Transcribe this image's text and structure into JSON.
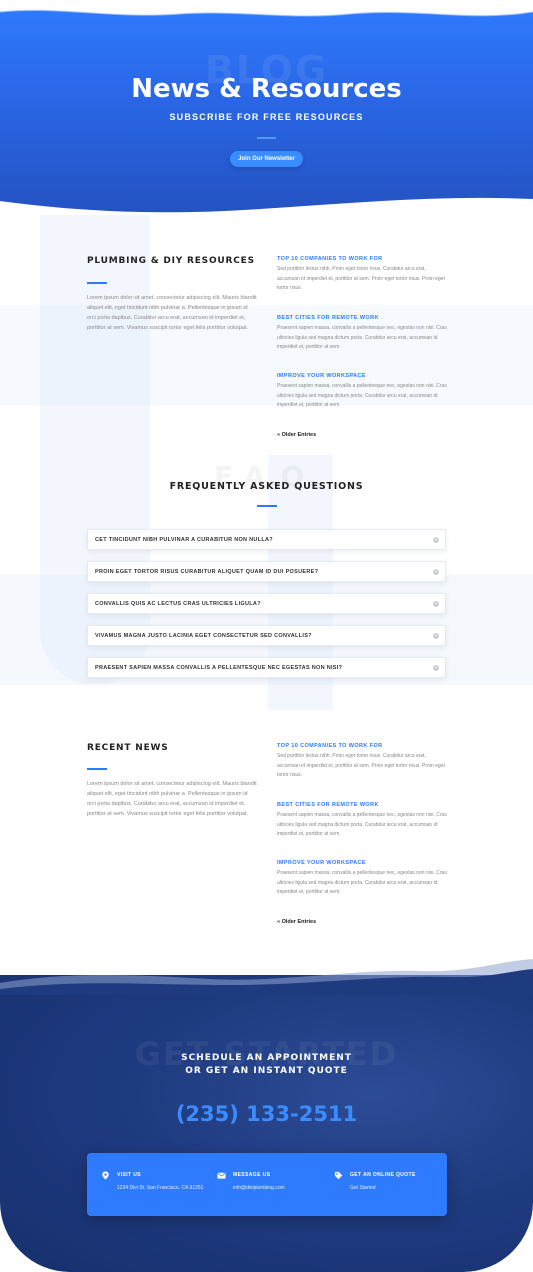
{
  "hero": {
    "ghost_text": "BLOG",
    "title": "News & Resources",
    "subtitle": "SUBSCRIBE FOR FREE RESOURCES",
    "button_label": "Join Our Newsletter"
  },
  "resources": {
    "title": "PLUMBING & DIY RESOURCES",
    "intro": "Lorem ipsum dolor sit amet, consectetur adipiscing elit. Mauris blandit aliquet elit, eget tincidunt nibh pulvinar a. Pellentesque in ipsum id orci porta dapibus. Curabitur arcu erat, accumsan id imperdiet et, porttitor at sem. Vivamus suscipit tortor eget felis porttitor volutpat.",
    "posts": [
      {
        "title": "TOP 10 COMPANIES TO WORK FOR",
        "excerpt": "Sed porttitor lectus nibh. Proin eget tortor risus. Curabitur arcu erat, accumsan id imperdiet et, porttitor at sem. Proin eget tortor risus. Proin eget tortor risus."
      },
      {
        "title": "BEST CITIES FOR REMOTE WORK",
        "excerpt": "Praesent sapien massa, convallis a pellentesque nec, egestas non nisi. Cras ultricies ligula sed magna dictum porta. Curabitur arcu erat, accumsan id imperdiet et, porttitor at sem."
      },
      {
        "title": "IMPROVE YOUR WORKSPACE",
        "excerpt": "Praesent sapien massa, convallis a pellentesque nec, egestas non nisi. Cras ultricies ligula sed magna dictum porta. Curabitur arcu erat, accumsan id imperdiet et, porttitor at sem."
      }
    ],
    "older_label": "« Older Entries"
  },
  "faq": {
    "ghost_text": "F.A.Q.",
    "title": "FREQUENTLY ASKED QUESTIONS",
    "items": [
      {
        "question": "CET TINCIDUNT NIBH PULVINAR A CURABITUR NON NULLA?"
      },
      {
        "question": "PROIN EGET TORTOR RISUS CURABITUR ALIQUET QUAM ID DUI POSUERE?"
      },
      {
        "question": "CONVALLIS QUIS AC LECTUS CRAS ULTRICIES LIGULA?"
      },
      {
        "question": "VIVAMUS MAGNA JUSTO LACINIA EGET CONSECTETUR SED CONVALLIS?"
      },
      {
        "question": "PRAESENT SAPIEN MASSA CONVALLIS A PELLENTESQUE NEC EGESTAS NON NISI?"
      }
    ]
  },
  "news": {
    "title": "RECENT NEWS",
    "intro": "Lorem ipsum dolor sit amet, consectetur adipiscing elit. Mauris blandit aliquet elit, eget tincidunt nibh pulvinar a. Pellentesque in ipsum id orci porta dapibus. Curabitur arcu erat, accumsan id imperdiet et, porttitor at sem. Vivamus suscipit tortor eget felis porttitor volutpat.",
    "posts": [
      {
        "title": "TOP 10 COMPANIES TO WORK FOR",
        "excerpt": "Sed porttitor lectus nibh. Proin eget tortor risus. Curabitur arcu erat, accumsan id imperdiet et, porttitor at sem. Proin eget tortor risus. Proin eget tortor risus."
      },
      {
        "title": "BEST CITIES FOR REMOTE WORK",
        "excerpt": "Praesent sapien massa, convallis a pellentesque nec, egestas non nisi. Cras ultricies ligula sed magna dictum porta. Curabitur arcu erat, accumsan id imperdiet et, porttitor at sem."
      },
      {
        "title": "IMPROVE YOUR WORKSPACE",
        "excerpt": "Praesent sapien massa, convallis a pellentesque nec, egestas non nisi. Cras ultricies ligula sed magna dictum porta. Curabitur arcu erat, accumsan id imperdiet et, porttitor at sem."
      }
    ],
    "older_label": "« Older Entries"
  },
  "footer": {
    "ghost_text": "GET STARTED",
    "heading_line1": "SCHEDULE AN APPOINTMENT",
    "heading_line2": "OR GET AN INSTANT QUOTE",
    "phone": "(235) 133-2511",
    "contacts": [
      {
        "icon": "map-pin-icon",
        "label": "VISIT US",
        "value": "1234 Divi St. San Francisco, CA 91251"
      },
      {
        "icon": "envelope-icon",
        "label": "MESSAGE US",
        "value": "info@diviplumbing.com"
      },
      {
        "icon": "tag-icon",
        "label": "GET AN ONLINE QUOTE",
        "value": "Get Started"
      }
    ]
  },
  "colors": {
    "accent": "#2a7bff",
    "hero_blue": "#2a67e6",
    "footer_navy": "#1f3b80"
  }
}
